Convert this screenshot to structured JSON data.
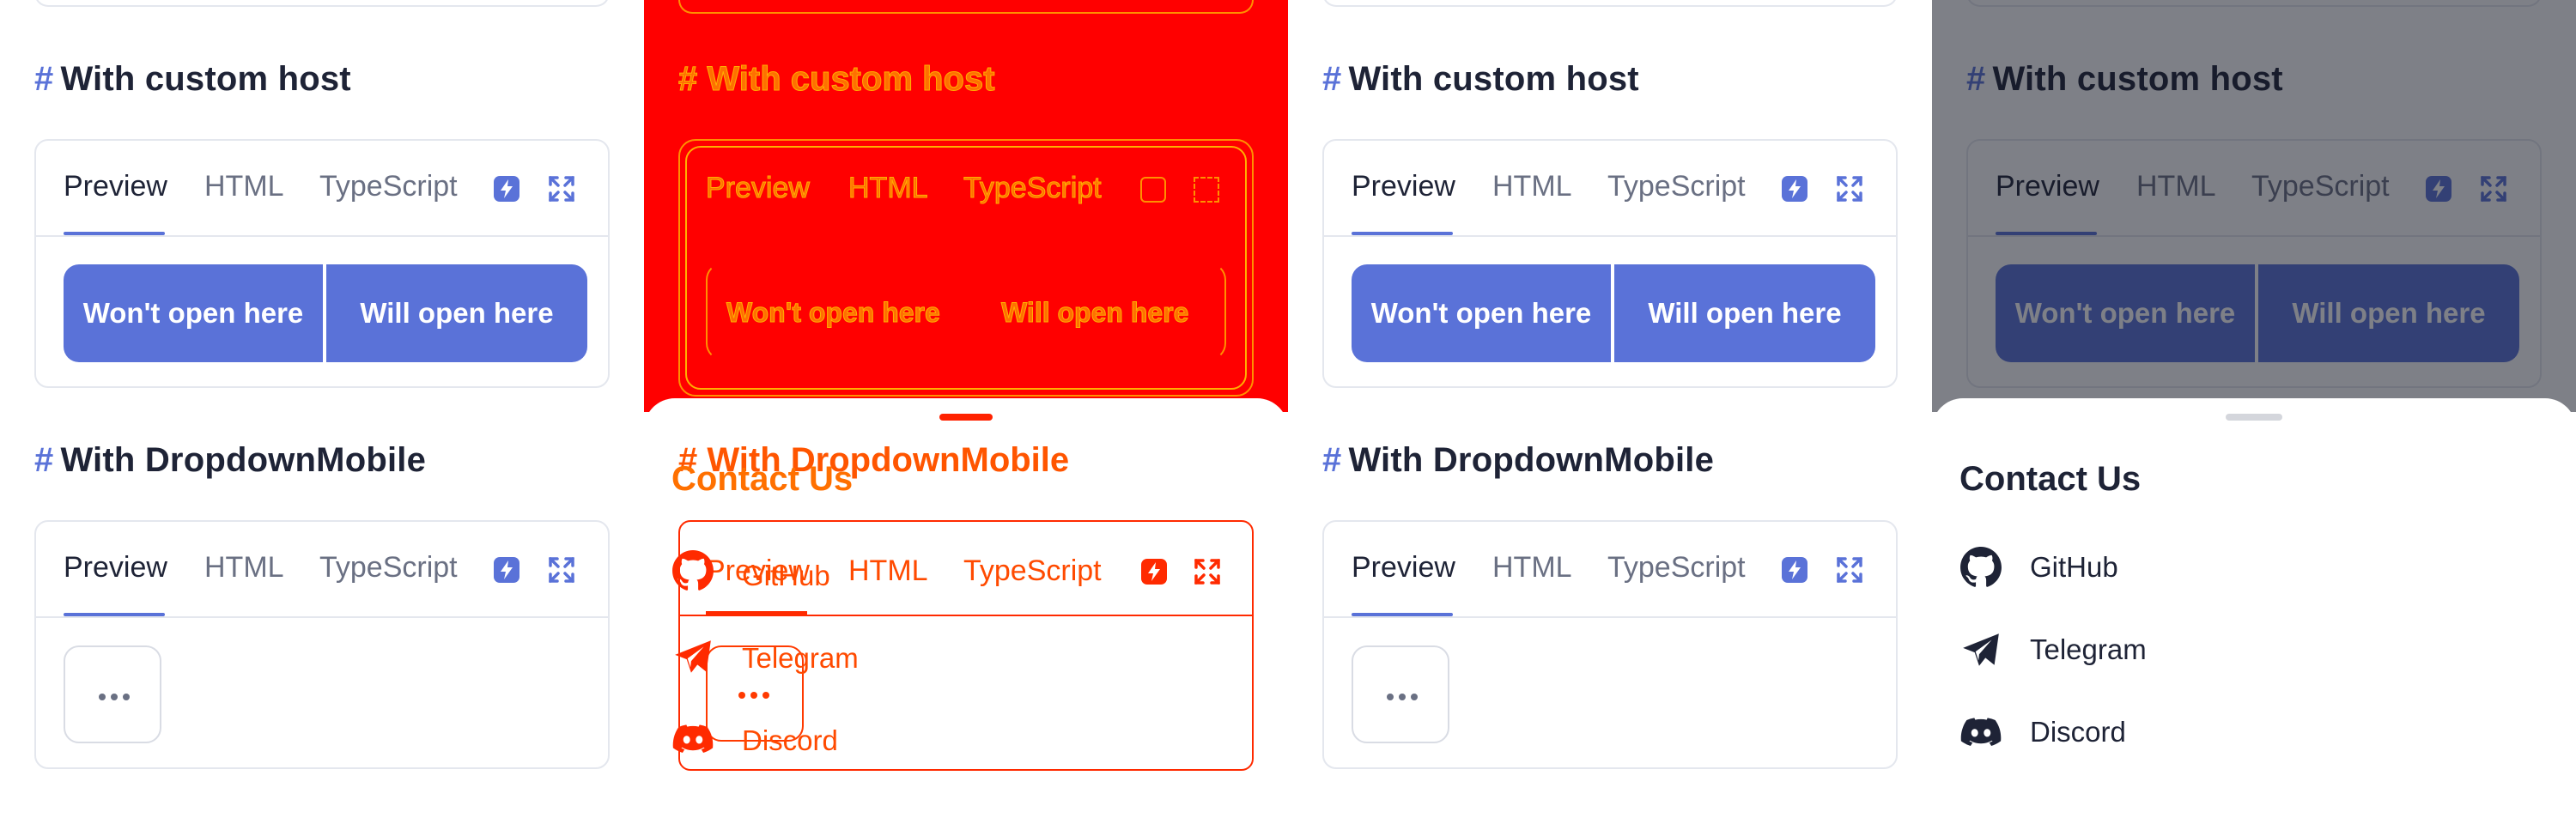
{
  "colors": {
    "accent": "#5a72d8",
    "text_dark": "#1e2336",
    "text_muted": "#6a7083",
    "border": "#e4e7ee",
    "debug_red": "#ff0000",
    "debug_orange": "#ff7000"
  },
  "sections": {
    "custom_host": {
      "hash": "#",
      "title": "With custom host",
      "tabs": [
        "Preview",
        "HTML",
        "TypeScript"
      ],
      "icons": [
        "stackblitz-icon",
        "fullscreen-icon"
      ],
      "buttons": [
        "Won't open here",
        "Will open here"
      ]
    },
    "dropdown_mobile": {
      "hash": "#",
      "title": "With DropdownMobile",
      "tabs": [
        "Preview",
        "HTML",
        "TypeScript"
      ],
      "icons": [
        "stackblitz-icon",
        "fullscreen-icon"
      ],
      "dots_label": "more-dots"
    }
  },
  "sheet": {
    "title": "Contact Us",
    "items": [
      {
        "label": "GitHub",
        "icon": "github-icon"
      },
      {
        "label": "Telegram",
        "icon": "telegram-icon"
      },
      {
        "label": "Discord",
        "icon": "discord-icon"
      }
    ]
  }
}
